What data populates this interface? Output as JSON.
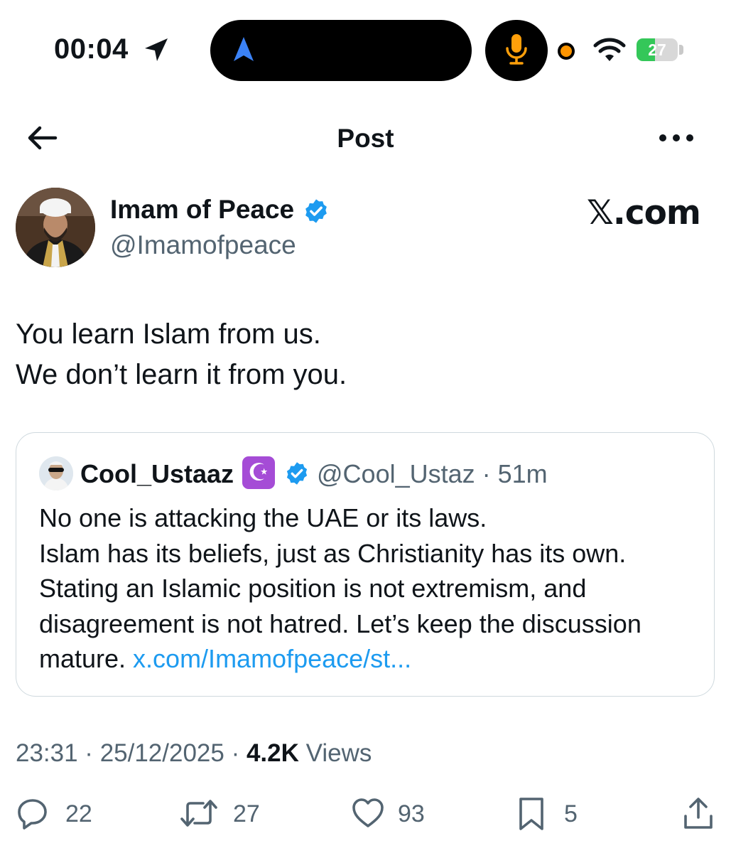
{
  "status_bar": {
    "time": "00:04",
    "battery_level": "27",
    "battery_fraction": 0.27,
    "icons": [
      "location-arrow-icon",
      "navigation-icon",
      "microphone-icon",
      "orange-dot-indicator",
      "wifi-icon",
      "battery-icon"
    ],
    "colors": {
      "mic": "#ff9f0a",
      "nav": "#3b82f6",
      "battery": "#34c759",
      "dot": "#ff9500"
    }
  },
  "header": {
    "title": "Post",
    "back_icon": "arrow-left-icon",
    "more_icon": "more-dots-icon"
  },
  "post": {
    "author": {
      "name": "Imam of Peace",
      "handle": "@Imamofpeace",
      "verified": true
    },
    "watermark": "𝕏.com",
    "text_lines": [
      "You learn Islam from us.",
      "We don’t learn it from you."
    ],
    "quote": {
      "author_name": "Cool_Ustaaz",
      "badge": "☪",
      "verified": true,
      "meta": "@Cool_Ustaz · 51m",
      "body_lines": [
        "No one is attacking the UAE or its laws.",
        "Islam has its beliefs, just as Christianity has its own.",
        "Stating an Islamic position is not extremism, and",
        "disagreement is not hatred. Let’s keep the discussion"
      ],
      "last_line_text": "mature. ",
      "link": "x.com/Imamofpeace/st..."
    },
    "timestamp": "23:31 · 25/12/2025 · ",
    "views_count": "4.2K",
    "views_label": " Views"
  },
  "actions": {
    "replies": "22",
    "reposts": "27",
    "likes": "93",
    "bookmarks": "5"
  },
  "colors": {
    "accent": "#1d9bf0",
    "secondary_text": "#536471",
    "border": "#cfd9de",
    "badge_purple": "#a54cd6"
  }
}
